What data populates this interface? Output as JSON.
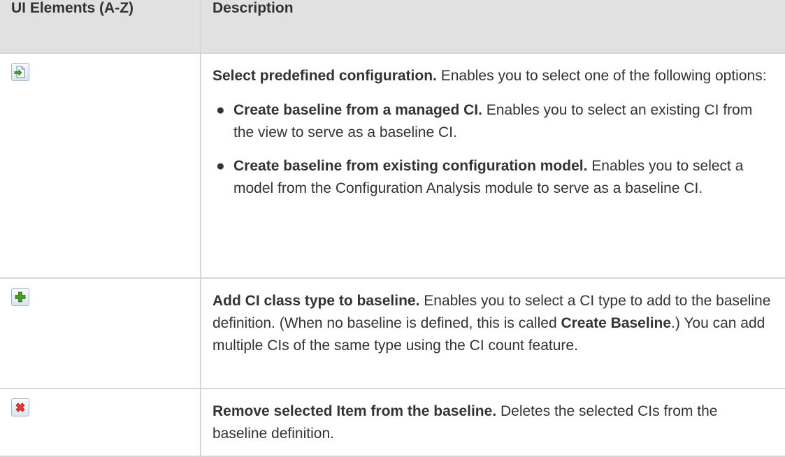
{
  "table": {
    "headers": [
      "UI Elements (A-Z)",
      "Description"
    ],
    "rows": [
      {
        "icon": "select-predefined-configuration-icon",
        "title": "Select predefined configuration.",
        "text": " Enables you to select one of the following options:",
        "options": [
          {
            "title": "Create baseline from a managed CI.",
            "text": " Enables you to select an existing CI from the view to serve as a baseline CI."
          },
          {
            "title": "Create baseline from existing configuration model.",
            "text": " Enables you to select a model from the Configuration Analysis module to serve as a baseline CI."
          }
        ]
      },
      {
        "icon": "add-icon",
        "title": "Add CI class type to baseline.",
        "text_before": " Enables you to select a CI type to add to the baseline definition. (When no baseline is defined, this is called ",
        "emphasis": "Create Baseline",
        "text_after": ".) You can add multiple CIs of the same type using the CI count feature."
      },
      {
        "icon": "remove-icon",
        "title": "Remove selected Item from the baseline.",
        "text": " Deletes the selected CIs from the baseline definition."
      }
    ]
  },
  "colors": {
    "header_background": "#e1e1e1",
    "border": "#d6d6d6",
    "text": "#333333",
    "add_icon_green": "#4c9a1e",
    "remove_icon_red": "#e03c31"
  }
}
